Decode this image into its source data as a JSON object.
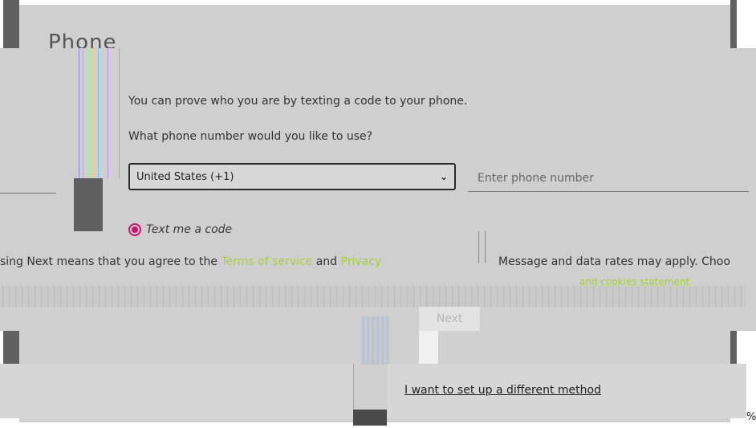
{
  "page": {
    "title_partial": "Phone",
    "prompt_line_1": "You can prove who you are by texting a code to your phone.",
    "prompt_line_2": "What phone number would you like to use?"
  },
  "country_select": {
    "value": "United States (+1)"
  },
  "phone_input": {
    "placeholder": "Enter phone number",
    "value": ""
  },
  "method": {
    "selected_label": "Text me a code"
  },
  "legal": {
    "prefix": "sing Next means that you agree to the ",
    "terms_label": "Terms of service",
    "and": " and ",
    "privacy_label": "Privacy",
    "rates_text": "Message and data rates may apply. Choo",
    "cookies_label": "and cookies statement"
  },
  "actions": {
    "next_label": "Next",
    "alt_method_label": "I want to set up a different method"
  },
  "overlay": {
    "corner_text": "%"
  },
  "colors": {
    "accent_radio": "#d0106f",
    "link_green": "#a6d13a"
  }
}
